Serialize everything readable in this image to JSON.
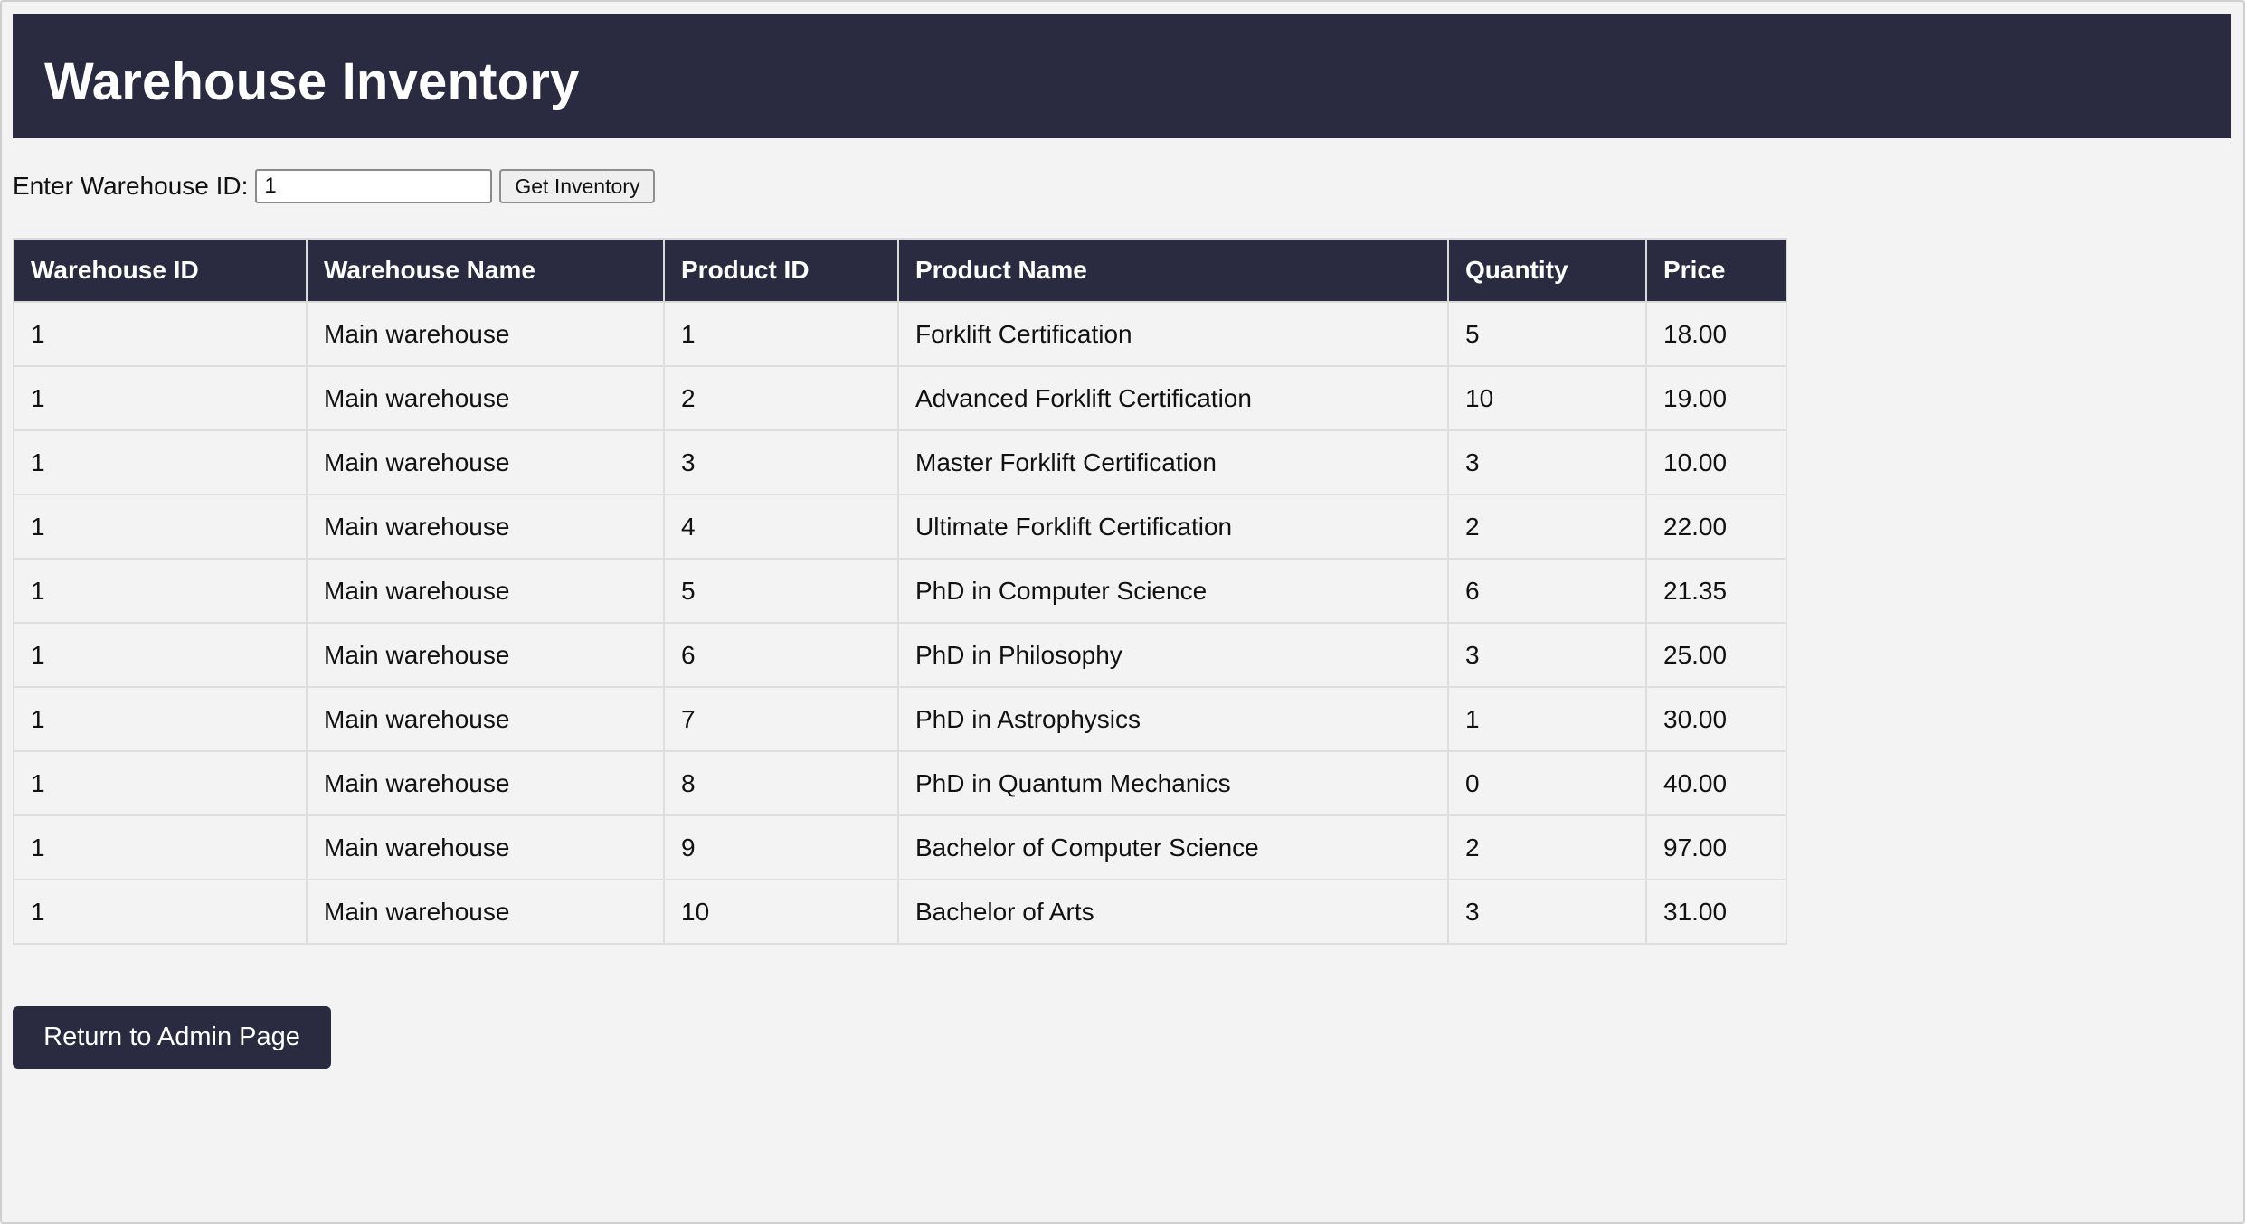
{
  "header": {
    "title": "Warehouse Inventory"
  },
  "form": {
    "label": "Enter Warehouse ID:",
    "input_value": "1",
    "button_label": "Get Inventory"
  },
  "table": {
    "columns": [
      "Warehouse ID",
      "Warehouse Name",
      "Product ID",
      "Product Name",
      "Quantity",
      "Price"
    ],
    "rows": [
      [
        "1",
        "Main warehouse",
        "1",
        "Forklift Certification",
        "5",
        "18.00"
      ],
      [
        "1",
        "Main warehouse",
        "2",
        "Advanced Forklift Certification",
        "10",
        "19.00"
      ],
      [
        "1",
        "Main warehouse",
        "3",
        "Master Forklift Certification",
        "3",
        "10.00"
      ],
      [
        "1",
        "Main warehouse",
        "4",
        "Ultimate Forklift Certification",
        "2",
        "22.00"
      ],
      [
        "1",
        "Main warehouse",
        "5",
        "PhD in Computer Science",
        "6",
        "21.35"
      ],
      [
        "1",
        "Main warehouse",
        "6",
        "PhD in Philosophy",
        "3",
        "25.00"
      ],
      [
        "1",
        "Main warehouse",
        "7",
        "PhD in Astrophysics",
        "1",
        "30.00"
      ],
      [
        "1",
        "Main warehouse",
        "8",
        "PhD in Quantum Mechanics",
        "0",
        "40.00"
      ],
      [
        "1",
        "Main warehouse",
        "9",
        "Bachelor of Computer Science",
        "2",
        "97.00"
      ],
      [
        "1",
        "Main warehouse",
        "10",
        "Bachelor of Arts",
        "3",
        "31.00"
      ]
    ]
  },
  "footer": {
    "return_label": "Return to Admin Page"
  },
  "colors": {
    "header_bg": "#2a2a40",
    "page_bg": "#f3f3f3",
    "header_text": "#ffffff"
  }
}
